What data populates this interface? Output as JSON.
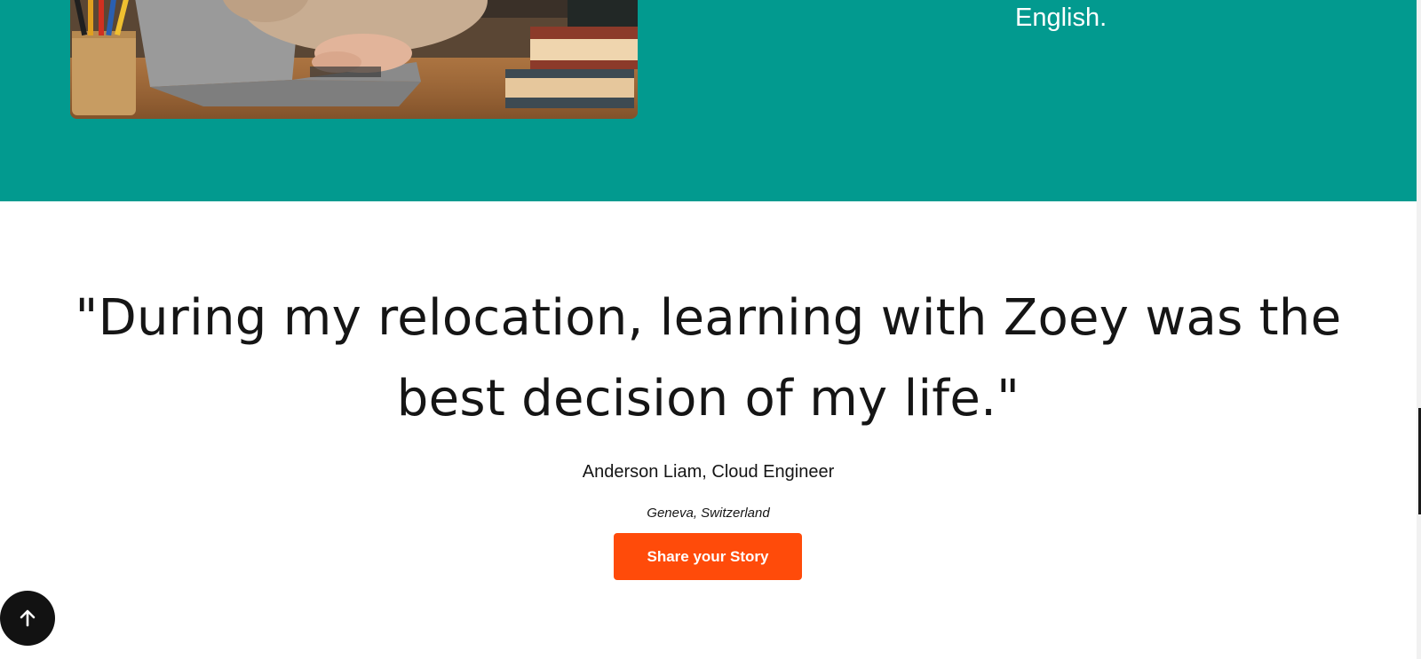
{
  "hero": {
    "text": "English.",
    "background_color": "#029a8f",
    "image": "woman-typing-on-laptop-with-books-and-pencils"
  },
  "testimonial": {
    "quote": "\"During my relocation, learning with Zoey was the best decision of my life.\"",
    "author": "Anderson Liam, Cloud Engineer",
    "location": "Geneva, Switzerland",
    "button_label": "Share your Story",
    "button_color": "#ff4b0a"
  },
  "scroll_top": {
    "icon": "arrow-up-icon"
  }
}
